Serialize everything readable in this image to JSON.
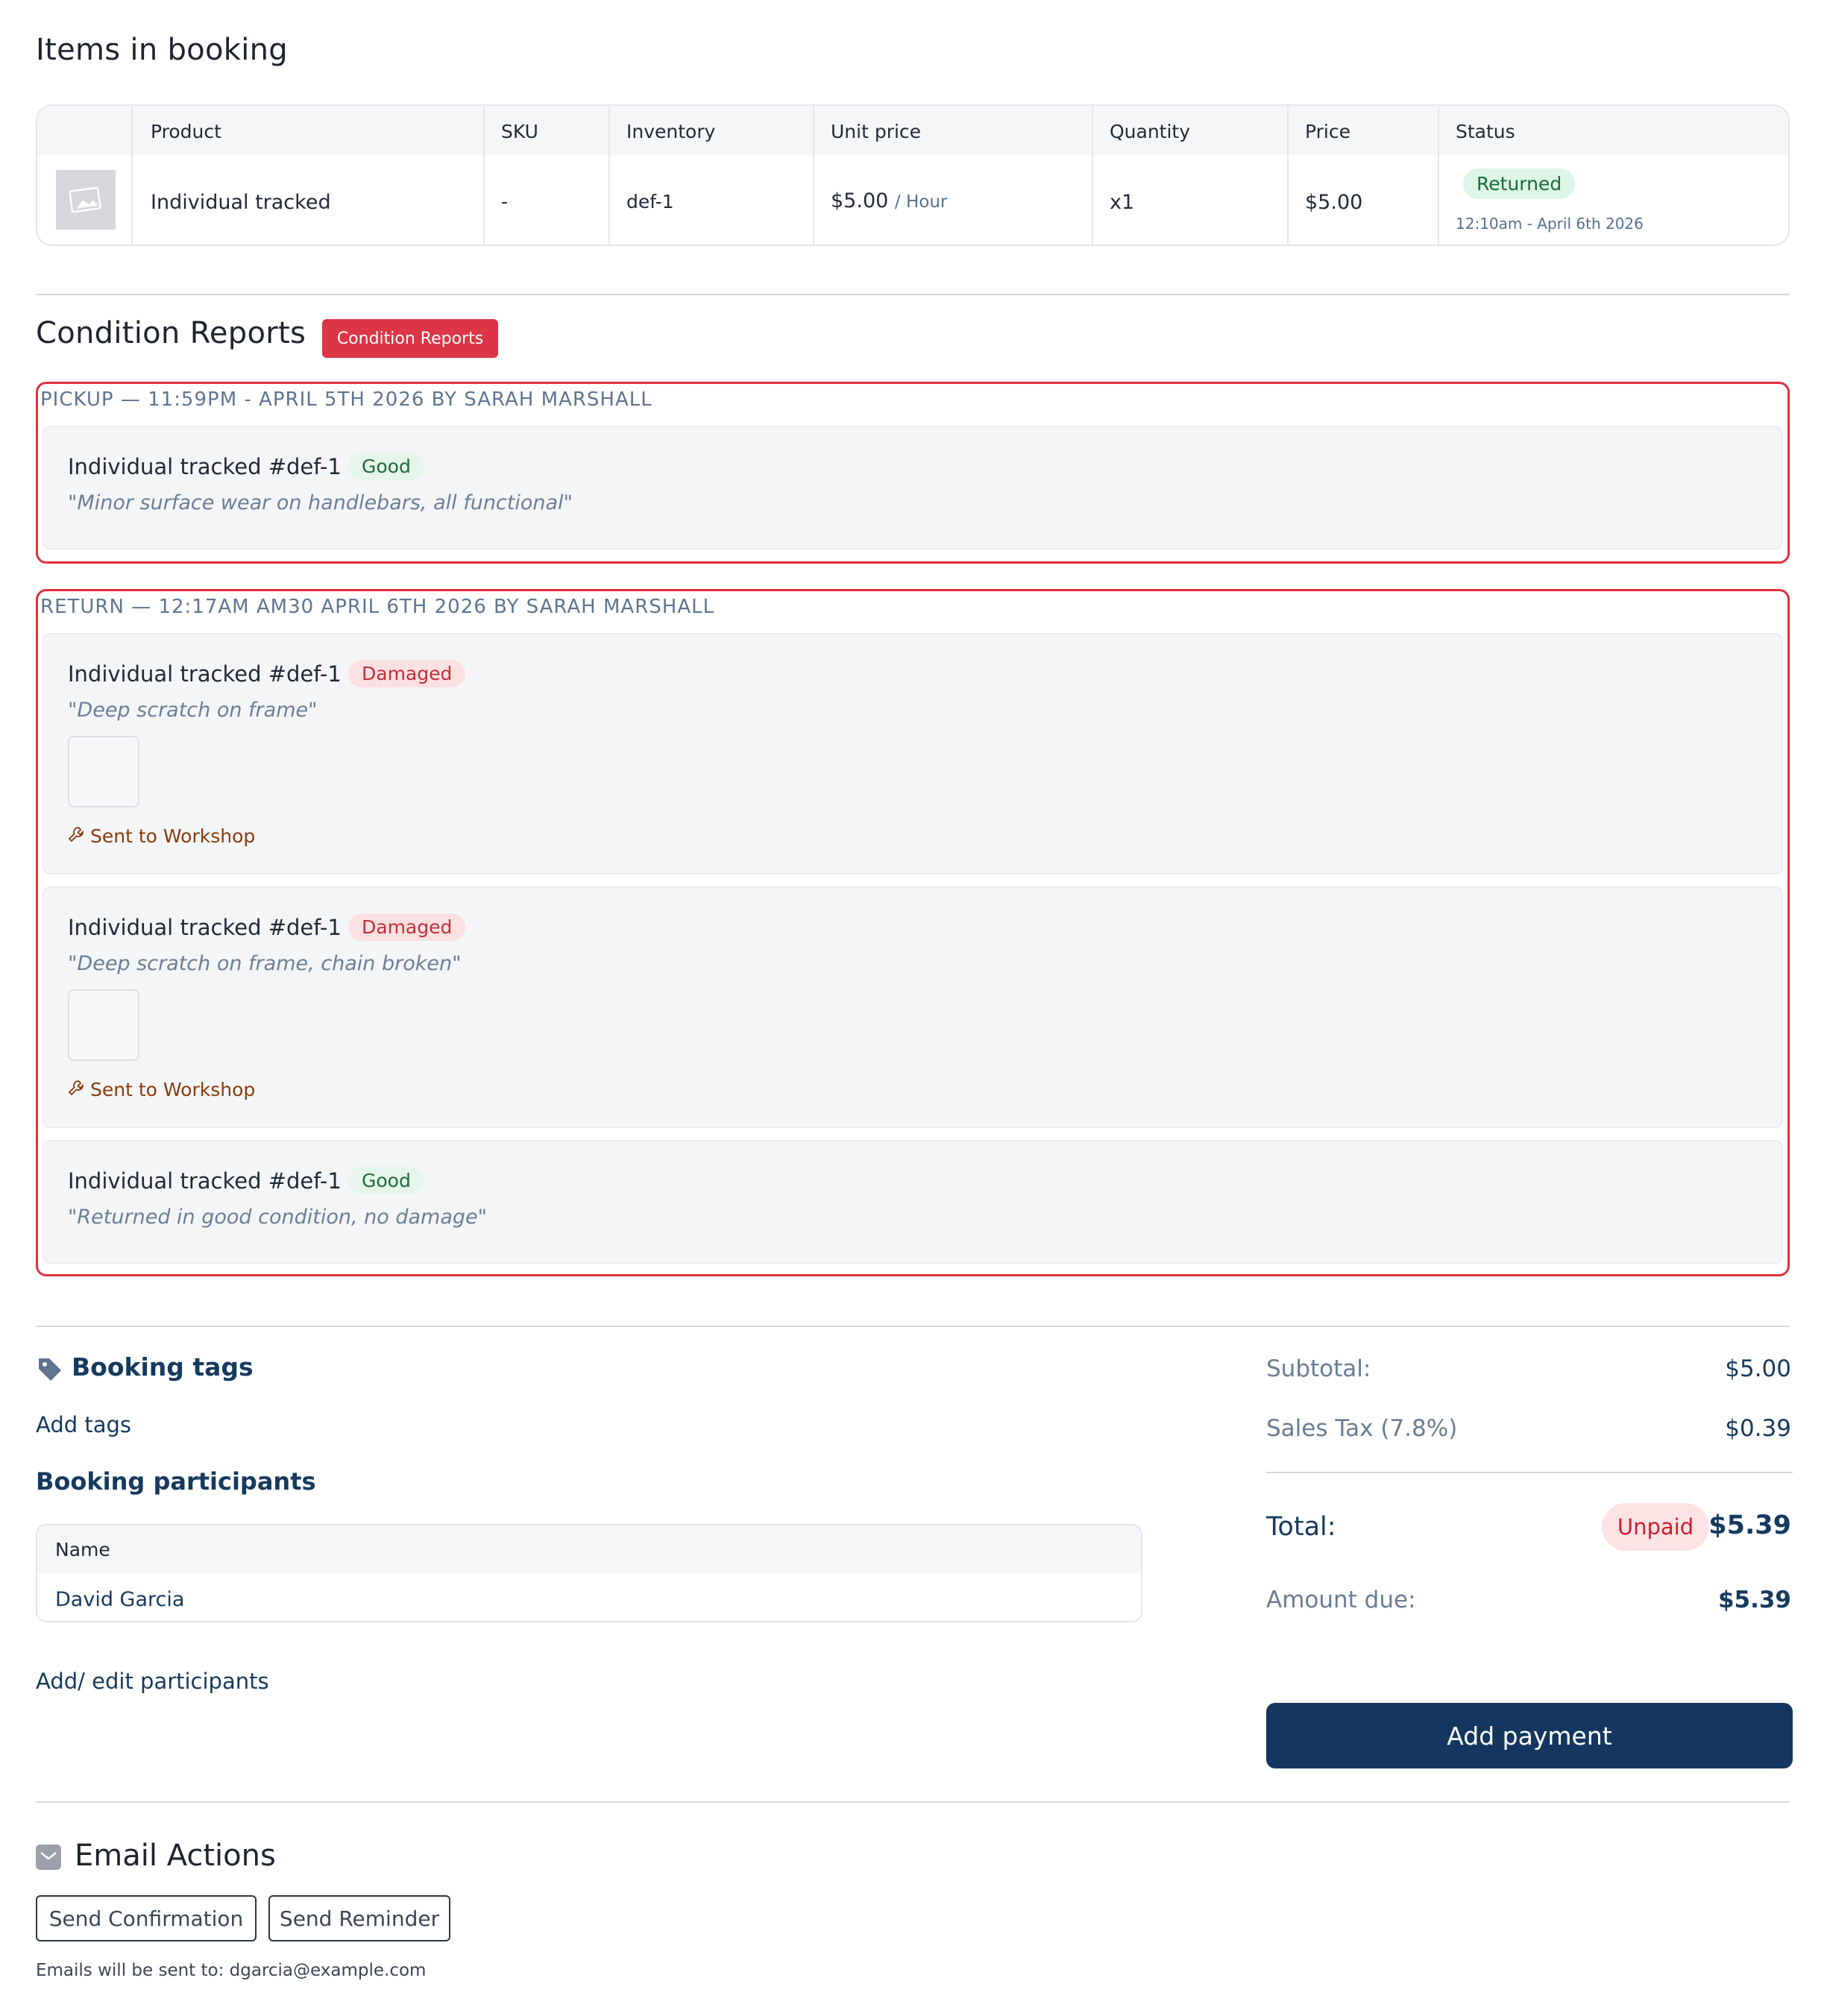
{
  "items_section": {
    "title": "Items in booking",
    "columns": [
      "Product",
      "SKU",
      "Inventory",
      "Unit price",
      "Quantity",
      "Price",
      "Status"
    ],
    "rows": [
      {
        "product": "Individual tracked",
        "sku": "-",
        "inventory": "def-1",
        "unit_price": "$5.00",
        "unit": "/ Hour",
        "quantity": "x1",
        "price": "$5.00",
        "status": "Returned",
        "status_time": "12:10am - April 6th 2026"
      }
    ]
  },
  "condition_reports": {
    "title": "Condition Reports",
    "badge": "Condition Reports",
    "groups": [
      {
        "heading": "PICKUP — 11:59PM - APRIL 5TH 2026 BY SARAH MARSHALL",
        "entries": [
          {
            "item": "Individual tracked #def-1",
            "condition": "Good",
            "note": "\"Minor surface wear on handlebars, all functional\""
          }
        ]
      },
      {
        "heading": "RETURN — 12:17AM AM30 APRIL 6TH 2026 BY SARAH MARSHALL",
        "entries": [
          {
            "item": "Individual tracked #def-1",
            "condition": "Damaged",
            "note": "\"Deep scratch on frame\"",
            "action": "Sent to Workshop"
          },
          {
            "item": "Individual tracked #def-1",
            "condition": "Damaged",
            "note": "\"Deep scratch on frame, chain broken\"",
            "action": "Sent to Workshop"
          },
          {
            "item": "Individual tracked #def-1",
            "condition": "Good",
            "note": "\"Returned in good condition, no damage\""
          }
        ]
      }
    ]
  },
  "booking_tags": {
    "title": "Booking tags",
    "add_link": "Add tags",
    "icon": "tag-icon"
  },
  "participants": {
    "title": "Booking participants",
    "column": "Name",
    "names": [
      "David Garcia"
    ],
    "edit_link": "Add/ edit participants"
  },
  "totals": {
    "subtotal_label": "Subtotal:",
    "subtotal": "$5.00",
    "tax_label": "Sales Tax (7.8%)",
    "tax": "$0.39",
    "total_label": "Total:",
    "payment_status": "Unpaid",
    "total": "$5.39",
    "due_label": "Amount due:",
    "due": "$5.39",
    "add_payment": "Add payment"
  },
  "email_actions": {
    "title": "Email Actions",
    "icon": "mail-icon",
    "send_confirmation": "Send Confirmation",
    "send_reminder": "Send Reminder",
    "note": "Emails will be sent to: dgarcia@example.com"
  },
  "colors": {
    "accent_red": "#dc3545",
    "navy": "#143760",
    "good_green": "#1d6b39",
    "damaged_red": "#c0303a"
  }
}
